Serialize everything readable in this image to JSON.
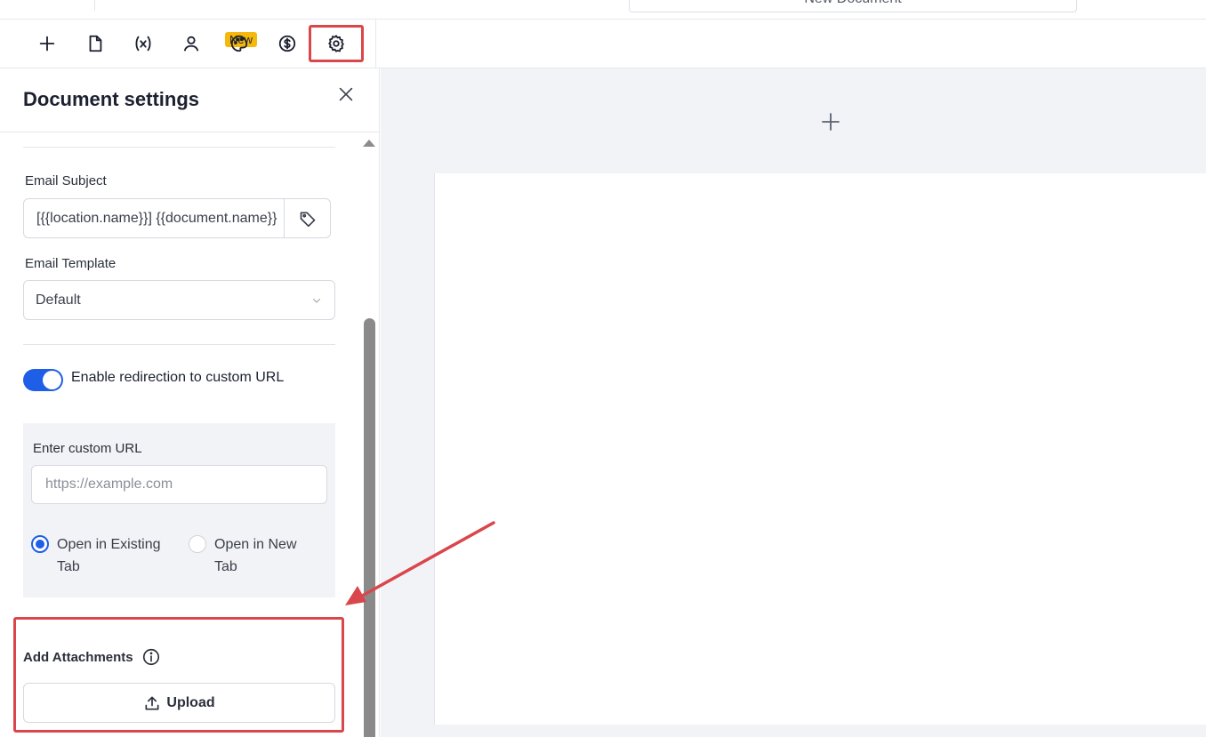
{
  "header": {
    "document_title": "New Document"
  },
  "toolbar": {
    "new_badge": "New",
    "tools": [
      {
        "name": "add",
        "icon": "plus-icon"
      },
      {
        "name": "pages",
        "icon": "document-icon"
      },
      {
        "name": "variables",
        "icon": "variable-icon"
      },
      {
        "name": "recipients",
        "icon": "user-icon"
      },
      {
        "name": "styles",
        "icon": "palette-icon"
      },
      {
        "name": "pricing",
        "icon": "dollar-icon"
      },
      {
        "name": "settings",
        "icon": "gear-icon",
        "active": true
      }
    ]
  },
  "panel": {
    "title": "Document settings",
    "email_subject": {
      "label": "Email Subject",
      "value": "[{{location.name}}] {{document.name}}"
    },
    "email_template": {
      "label": "Email Template",
      "selected": "Default"
    },
    "redirect": {
      "toggle_label": "Enable redirection to custom URL",
      "enabled": true,
      "url_label": "Enter custom URL",
      "url_placeholder": "https://example.com",
      "option_existing_line1": "Open in Existing",
      "option_existing_line2": "Tab",
      "option_new_line1": "Open in New",
      "option_new_line2": "Tab",
      "selected_option": "existing"
    },
    "attachments": {
      "label": "Add Attachments",
      "upload_label": "Upload"
    }
  },
  "colors": {
    "accent": "#1f5ee6",
    "highlight": "#d9464b",
    "badge": "#f5b80c",
    "canvas_bg": "#f2f3f7"
  }
}
